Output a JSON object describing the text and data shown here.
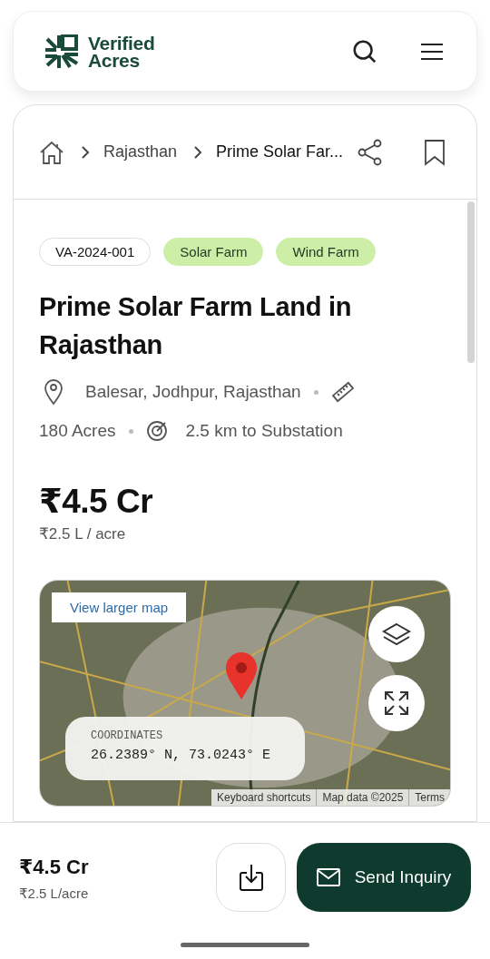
{
  "header": {
    "logo_line_1": "Verified",
    "logo_line_2": "Acres"
  },
  "breadcrumb": {
    "items": [
      "Rajasthan",
      "Prime Solar Far..."
    ]
  },
  "tags": [
    {
      "label": "VA-2024-001",
      "kind": "id"
    },
    {
      "label": "Solar Farm",
      "kind": "category"
    },
    {
      "label": "Wind Farm",
      "kind": "category"
    }
  ],
  "title": "Prime Solar Farm Land in Rajasthan",
  "location": "Balesar, Jodhpur, Rajasthan",
  "area": "180 Acres",
  "substation": "2.5 km to Substation",
  "price": "₹4.5 Cr",
  "price_per_acre": "₹2.5 L / acre",
  "map": {
    "link": "View larger map",
    "coordinates_label": "COORDINATES",
    "coordinates": "26.2389° N, 73.0243° E",
    "attribution": [
      "Keyboard shortcuts",
      "Map data ©2025",
      "Terms"
    ]
  },
  "bottom_bar": {
    "price": "₹4.5 Cr",
    "price_per_acre": "₹2.5 L/acre",
    "button": "Send Inquiry"
  }
}
